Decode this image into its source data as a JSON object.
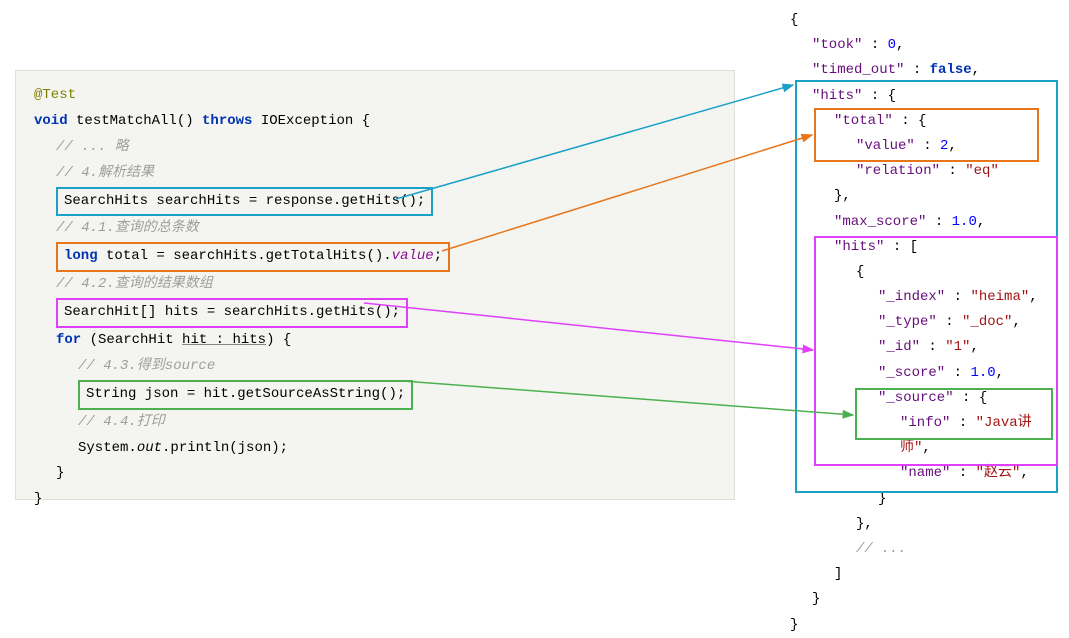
{
  "java": {
    "at": "@Test",
    "void": "void",
    "fn": " testMatchAll() ",
    "throws": "throws",
    "ex": " IOException {",
    "c1": "// ... 略",
    "c2": "// 4.解析结果",
    "line_hits": "SearchHits searchHits = response.getHits();",
    "c3": "// 4.1.查询的总条数",
    "long": "long",
    "line_total_mid": " total = searchHits.getTotalHits().",
    "value": "value",
    "semi": ";",
    "c4": "// 4.2.查询的结果数组",
    "line_arr": "SearchHit[] hits = searchHits.getHits();",
    "for": "for",
    "for_mid": " (SearchHit ",
    "for_u": "hit : hits",
    "for_end": ") {",
    "c5": "// 4.3.得到source",
    "line_src": "String json = hit.getSourceAsString();",
    "c6": "// 4.4.打印",
    "sysout_a": "System.",
    "sysout_out": "out",
    "sysout_b": ".println(json);",
    "brace": "}"
  },
  "json": {
    "l0": "{",
    "took_k": "\"took\"",
    "took_v": "0",
    "timed_k": "\"timed_out\"",
    "timed_v": "false",
    "hits_k": "\"hits\"",
    "total_k": "\"total\"",
    "value_k": "\"value\"",
    "value_v": "2",
    "relation_k": "\"relation\"",
    "relation_v": "\"eq\"",
    "max_k": "\"max_score\"",
    "max_v": "1.0",
    "hits2_k": "\"hits\"",
    "index_k": "\"_index\"",
    "index_v": "\"heima\"",
    "type_k": "\"_type\"",
    "type_v": "\"_doc\"",
    "id_k": "\"_id\"",
    "id_v": "\"1\"",
    "score_k": "\"_score\"",
    "score_v": "1.0",
    "source_k": "\"_source\"",
    "info_k": "\"info\"",
    "info_v": "\"Java讲师\"",
    "name_k": "\"name\"",
    "name_v": "\"赵云\"",
    "ellipsis": "// ...",
    "colon": " : ",
    "comma": ",",
    "obr": " : {",
    "oarr": " : [",
    "cbr": "}",
    "cbrcomma": "},",
    "carr": "]"
  }
}
